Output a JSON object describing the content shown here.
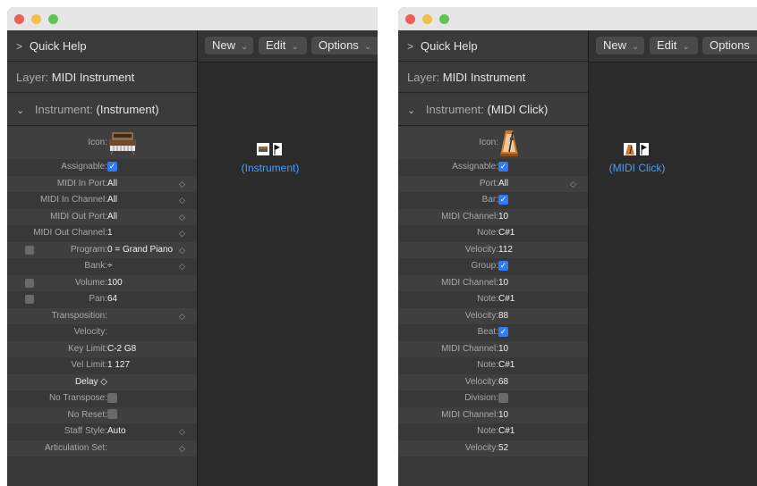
{
  "left_window": {
    "toolbar": {
      "new_label": "New",
      "edit_label": "Edit",
      "options_label": "Options"
    },
    "quick_help": "Quick Help",
    "layer": {
      "label": "Layer:",
      "value": "MIDI Instrument"
    },
    "object": {
      "label": "Instrument:",
      "value": "(Instrument)"
    },
    "icon_label": "Icon:",
    "rows": [
      {
        "label": "Assignable:",
        "value": "",
        "checked": true
      },
      {
        "label": "MIDI In Port:",
        "value": "All",
        "stepper": true
      },
      {
        "label": "MIDI In Channel:",
        "value": "All",
        "stepper": true
      },
      {
        "label": "MIDI Out Port:",
        "value": "All",
        "stepper": true
      },
      {
        "label": "MIDI Out Channel:",
        "value": "1",
        "stepper": true
      },
      {
        "label": "Program:",
        "value": "0 = Grand Piano",
        "stepper": true,
        "left_check": true
      },
      {
        "label": "Bank:",
        "value": "÷",
        "stepper": true
      },
      {
        "label": "Volume:",
        "value": "100",
        "left_check": true
      },
      {
        "label": "Pan:",
        "value": "64",
        "left_check": true
      },
      {
        "label": "Transposition:",
        "value": "",
        "stepper": true
      },
      {
        "label": "Velocity:",
        "value": ""
      },
      {
        "label": "Key Limit:",
        "value": "C-2  G8"
      },
      {
        "label": "Vel Limit:",
        "value": "1  127"
      },
      {
        "label": "Delay ◇",
        "value": "",
        "white": true
      },
      {
        "label": "No Transpose:",
        "value": "",
        "checked": false
      },
      {
        "label": "No Reset:",
        "value": "",
        "checked": false
      },
      {
        "label": "Staff Style:",
        "value": "Auto",
        "stepper": true
      },
      {
        "label": "Articulation Set:",
        "value": "",
        "stepper": true
      }
    ],
    "node_label": "(Instrument)"
  },
  "right_window": {
    "toolbar": {
      "new_label": "New",
      "edit_label": "Edit",
      "options_label": "Options"
    },
    "quick_help": "Quick Help",
    "layer": {
      "label": "Layer:",
      "value": "MIDI Instrument"
    },
    "object": {
      "label": "Instrument:",
      "value": "(MIDI Click)"
    },
    "icon_label": "Icon:",
    "rows": [
      {
        "label": "Assignable:",
        "value": "",
        "checked": true
      },
      {
        "label": "Port:",
        "value": "All",
        "stepper": true
      },
      {
        "label": "Bar:",
        "value": "",
        "checked": true
      },
      {
        "label": "MIDI Channel:",
        "value": "10"
      },
      {
        "label": "Note:",
        "value": "C#1"
      },
      {
        "label": "Velocity:",
        "value": "112"
      },
      {
        "label": "Group:",
        "value": "",
        "checked": true
      },
      {
        "label": "MIDI Channel:",
        "value": "10"
      },
      {
        "label": "Note:",
        "value": "C#1"
      },
      {
        "label": "Velocity:",
        "value": "88"
      },
      {
        "label": "Beat:",
        "value": "",
        "checked": true
      },
      {
        "label": "MIDI Channel:",
        "value": "10"
      },
      {
        "label": "Note:",
        "value": "C#1"
      },
      {
        "label": "Velocity:",
        "value": "68"
      },
      {
        "label": "Division:",
        "value": "",
        "checked": false
      },
      {
        "label": "MIDI Channel:",
        "value": "10"
      },
      {
        "label": "Note:",
        "value": "C#1"
      },
      {
        "label": "Velocity:",
        "value": "52"
      }
    ],
    "node_label": "(MIDI Click)"
  },
  "icons": {
    "window_controls": [
      "close-button",
      "minimize-button",
      "zoom-button"
    ],
    "left_instrument_icon": "keyboard-synth-icon",
    "right_instrument_icon": "metronome-icon",
    "disclosure": "chevron-right-icon",
    "expanded": "chevron-down-icon",
    "stepper": "up-down-stepper-icon",
    "checkmark": "checkmark-icon"
  },
  "colors": {
    "accent": "#2f7df6",
    "link_label": "#4d9df5",
    "panel_bg": "#383838",
    "canvas_bg": "#2b2b2b"
  }
}
